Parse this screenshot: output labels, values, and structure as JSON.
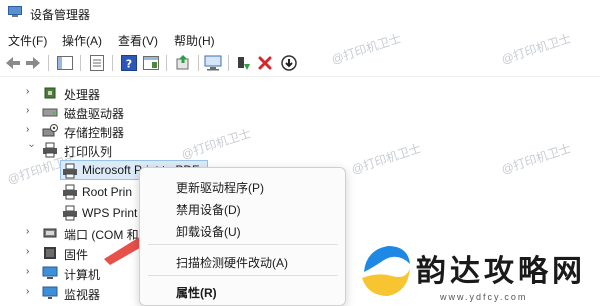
{
  "window": {
    "title": "设备管理器"
  },
  "menu": [
    "文件(F)",
    "操作(A)",
    "查看(V)",
    "帮助(H)"
  ],
  "tree": {
    "items": [
      {
        "label": "处理器",
        "icon": "processor-icon",
        "expanded": false
      },
      {
        "label": "磁盘驱动器",
        "icon": "disk-icon",
        "expanded": false
      },
      {
        "label": "存储控制器",
        "icon": "storage-controller-icon",
        "expanded": false
      },
      {
        "label": "打印队列",
        "icon": "printer-icon",
        "expanded": true,
        "children": [
          "Microsoft Print to PDF",
          "Root Print Queue",
          "WPS Print"
        ]
      },
      {
        "label": "端口 (COM 和",
        "icon": "port-icon",
        "expanded": false
      },
      {
        "label": "固件",
        "icon": "firmware-icon",
        "expanded": false
      },
      {
        "label": "计算机",
        "icon": "computer-icon",
        "expanded": false
      },
      {
        "label": "监视器",
        "icon": "monitor-icon",
        "expanded": false
      }
    ],
    "visible_child_labels": [
      "Microsoft Print to PDF",
      "Root Prin",
      "WPS Print"
    ]
  },
  "context_menu": {
    "items": [
      "更新驱动程序(P)",
      "禁用设备(D)",
      "卸载设备(U)",
      "扫描检测硬件改动(A)",
      "属性(R)"
    ]
  },
  "watermark": "@打印机卫士",
  "logo": {
    "text": "韵达攻略网",
    "url": "www.ydfcy.com"
  },
  "colors": {
    "selection": "#ddeaf7",
    "arrow": "#e8504a",
    "logo_blue": "#1e88e5",
    "logo_yellow": "#f7c531",
    "delete_red": "#d6262c"
  }
}
